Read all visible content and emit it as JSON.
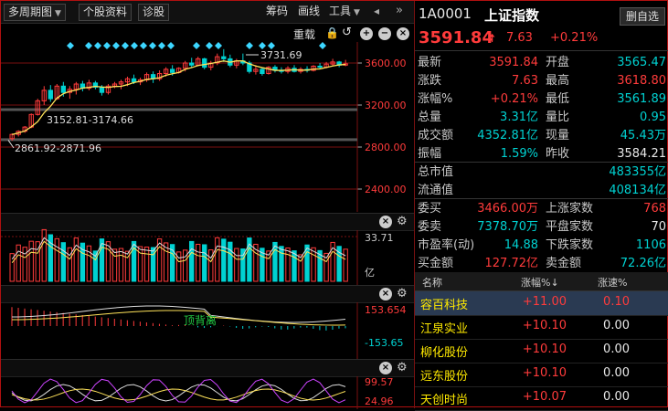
{
  "toolbar": {
    "period_label": "多周期图",
    "stock_info_label": "个股资料",
    "diagnose_label": "诊股",
    "chips_label": "筹码",
    "draw_label": "画线",
    "tools_label": "工具",
    "collapse_glyph": "»"
  },
  "chart": {
    "reload_label": "重载",
    "price_ticks": [
      "3600.00",
      "3200.00",
      "2800.00",
      "2400.00"
    ],
    "annotations": {
      "high": "3731.69",
      "mid": "3152.81-3174.66",
      "low": "2861.92-2871.96"
    },
    "volume_tick_top": "33.71",
    "volume_unit": "亿",
    "macd_tick_top": "153.654",
    "macd_tick_bottom": "-153.65",
    "macd_signal": "顶背离",
    "kdj_tick_top": "99.57",
    "kdj_tick_bottom": "24.96",
    "colors": {
      "up": "#ff3b3b",
      "down": "#00d2d2",
      "ma": "#ffe35a",
      "grid": "#7a1010"
    }
  },
  "chart_data": {
    "type": "candlestick",
    "candles": [
      [
        2880,
        2930,
        2860,
        2920
      ],
      [
        2920,
        2960,
        2900,
        2950
      ],
      [
        2950,
        3000,
        2935,
        2990
      ],
      [
        2990,
        3120,
        2980,
        3110
      ],
      [
        3110,
        3260,
        3100,
        3240
      ],
      [
        3240,
        3380,
        3200,
        3340
      ],
      [
        3340,
        3390,
        3230,
        3260
      ],
      [
        3260,
        3400,
        3250,
        3380
      ],
      [
        3380,
        3420,
        3280,
        3320
      ],
      [
        3320,
        3380,
        3260,
        3350
      ],
      [
        3350,
        3420,
        3300,
        3400
      ],
      [
        3400,
        3430,
        3330,
        3360
      ],
      [
        3360,
        3440,
        3340,
        3410
      ],
      [
        3410,
        3430,
        3350,
        3370
      ],
      [
        3370,
        3390,
        3290,
        3320
      ],
      [
        3320,
        3400,
        3300,
        3380
      ],
      [
        3380,
        3420,
        3360,
        3400
      ],
      [
        3400,
        3440,
        3350,
        3420
      ],
      [
        3420,
        3470,
        3380,
        3450
      ],
      [
        3450,
        3490,
        3400,
        3420
      ],
      [
        3420,
        3460,
        3390,
        3440
      ],
      [
        3440,
        3510,
        3420,
        3490
      ],
      [
        3490,
        3520,
        3410,
        3450
      ],
      [
        3450,
        3530,
        3430,
        3500
      ],
      [
        3500,
        3560,
        3470,
        3540
      ],
      [
        3540,
        3580,
        3480,
        3510
      ],
      [
        3510,
        3560,
        3500,
        3550
      ],
      [
        3550,
        3620,
        3520,
        3600
      ],
      [
        3600,
        3650,
        3560,
        3580
      ],
      [
        3580,
        3660,
        3570,
        3640
      ],
      [
        3640,
        3650,
        3540,
        3560
      ],
      [
        3560,
        3620,
        3530,
        3600
      ],
      [
        3600,
        3690,
        3580,
        3660
      ],
      [
        3660,
        3732,
        3610,
        3640
      ],
      [
        3640,
        3680,
        3560,
        3580
      ],
      [
        3580,
        3640,
        3550,
        3620
      ],
      [
        3620,
        3690,
        3580,
        3600
      ],
      [
        3600,
        3620,
        3500,
        3520
      ],
      [
        3520,
        3580,
        3490,
        3540
      ],
      [
        3540,
        3560,
        3480,
        3500
      ],
      [
        3500,
        3570,
        3490,
        3560
      ],
      [
        3560,
        3580,
        3510,
        3530
      ],
      [
        3530,
        3560,
        3500,
        3520
      ],
      [
        3520,
        3570,
        3500,
        3550
      ],
      [
        3550,
        3580,
        3510,
        3520
      ],
      [
        3520,
        3560,
        3500,
        3540
      ],
      [
        3540,
        3570,
        3510,
        3530
      ],
      [
        3530,
        3580,
        3520,
        3570
      ],
      [
        3570,
        3600,
        3540,
        3560
      ],
      [
        3560,
        3610,
        3550,
        3590
      ],
      [
        3590,
        3640,
        3570,
        3610
      ],
      [
        3610,
        3620,
        3560,
        3580
      ],
      [
        3580,
        3630,
        3570,
        3592
      ]
    ],
    "ylim": [
      2200,
      3800
    ],
    "volume_ylim": [
      0,
      34
    ]
  },
  "quote": {
    "code": "1A0001",
    "name": "上证指数",
    "remove_label": "删自选",
    "price": "3591.84",
    "change": "7.63",
    "change_pct": "+0.21%",
    "rows": [
      {
        "l1": "最新",
        "v1": "3591.84",
        "c1": "red",
        "l2": "开盘",
        "v2": "3565.47",
        "c2": "grn"
      },
      {
        "l1": "涨跌",
        "v1": "7.63",
        "c1": "red",
        "l2": "最高",
        "v2": "3618.80",
        "c2": "red"
      },
      {
        "l1": "涨幅%",
        "v1": "+0.21%",
        "c1": "red",
        "l2": "最低",
        "v2": "3561.89",
        "c2": "grn"
      },
      {
        "l1": "总量",
        "v1": "3.31亿",
        "c1": "grn",
        "l2": "量比",
        "v2": "0.95",
        "c2": "grn"
      },
      {
        "l1": "成交额",
        "v1": "4352.81亿",
        "c1": "grn",
        "l2": "现量",
        "v2": "45.43万",
        "c2": "grn"
      },
      {
        "l1": "振幅",
        "v1": "1.59%",
        "c1": "grn",
        "l2": "昨收",
        "v2": "3584.21",
        "c2": "wht"
      },
      {
        "l1": "总市值",
        "v1": "",
        "c1": "wht",
        "l2": "",
        "v2": "483355亿",
        "c2": "grn"
      },
      {
        "l1": "流通值",
        "v1": "",
        "c1": "wht",
        "l2": "",
        "v2": "408134亿",
        "c2": "grn"
      },
      {
        "l1": "委买",
        "v1": "3466.00万",
        "c1": "red",
        "l2": "上涨家数",
        "v2": "768",
        "c2": "red"
      },
      {
        "l1": "委卖",
        "v1": "7378.70万",
        "c1": "grn",
        "l2": "平盘家数",
        "v2": "70",
        "c2": "wht"
      },
      {
        "l1": "市盈率(动)",
        "v1": "14.88",
        "c1": "grn",
        "l2": "下跌家数",
        "v2": "1106",
        "c2": "grn"
      },
      {
        "l1": "买金额",
        "v1": "127.72亿",
        "c1": "red",
        "l2": "卖金额",
        "v2": "72.26亿",
        "c2": "grn"
      }
    ]
  },
  "list": {
    "headers": {
      "name": "名称",
      "pct": "涨幅%↓",
      "speed": "涨速%"
    },
    "items": [
      {
        "name": "容百科技",
        "pct": "+11.00",
        "speed": "0.10"
      },
      {
        "name": "江泉实业",
        "pct": "+10.10",
        "speed": "0.00"
      },
      {
        "name": "柳化股份",
        "pct": "+10.10",
        "speed": "0.00"
      },
      {
        "name": "远东股份",
        "pct": "+10.10",
        "speed": "0.00"
      },
      {
        "name": "天创时尚",
        "pct": "+10.07",
        "speed": "0.00"
      }
    ]
  }
}
